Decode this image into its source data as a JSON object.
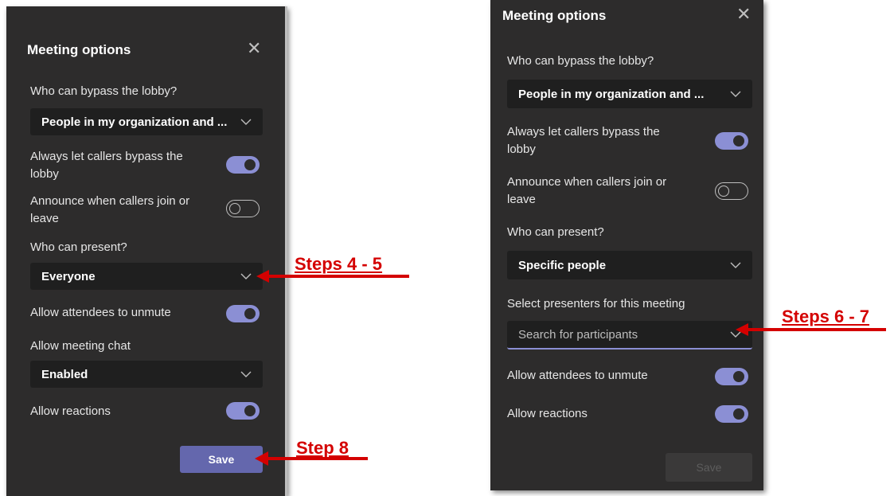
{
  "left_panel": {
    "title": "Meeting options",
    "lobby_label": "Who can bypass the lobby?",
    "lobby_value": "People in my organization and ...",
    "callers_bypass_label": "Always let callers bypass the lobby",
    "callers_bypass_on": true,
    "announce_label": "Announce when callers join or leave",
    "announce_on": false,
    "present_label": "Who can present?",
    "present_value": "Everyone",
    "unmute_label": "Allow attendees to unmute",
    "unmute_on": true,
    "chat_label": "Allow meeting chat",
    "chat_value": "Enabled",
    "reactions_label": "Allow reactions",
    "reactions_on": true,
    "save_label": "Save"
  },
  "right_panel": {
    "title": "Meeting options",
    "lobby_label": "Who can bypass the lobby?",
    "lobby_value": "People in my organization and ...",
    "callers_bypass_label": "Always let callers bypass the lobby",
    "callers_bypass_on": true,
    "announce_label": "Announce when callers join or leave",
    "announce_on": false,
    "present_label": "Who can present?",
    "present_value": "Specific people",
    "presenters_label": "Select presenters for this meeting",
    "presenters_placeholder": "Search for participants",
    "unmute_label": "Allow attendees to unmute",
    "unmute_on": true,
    "reactions_label": "Allow reactions",
    "reactions_on": true,
    "save_label": "Save"
  },
  "annotations": {
    "steps_4_5": "Steps 4 - 5",
    "step_8": "Step 8",
    "steps_6_7": "Steps 6 - 7"
  },
  "colors": {
    "panel_bg": "#2d2c2c",
    "dropdown_bg": "#1f1f1f",
    "accent": "#8b8fd4",
    "save_button": "#6467ad",
    "annotation_red": "#d40000"
  }
}
